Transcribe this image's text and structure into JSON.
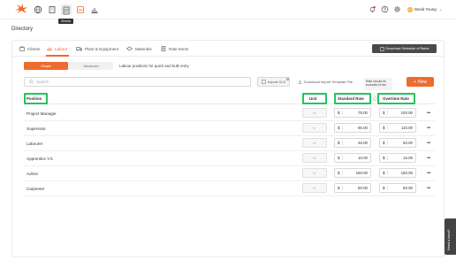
{
  "topbar": {
    "tooltip": "Sheets",
    "user": {
      "initials": "DY",
      "name": "David Young"
    }
  },
  "page": {
    "title": "Directory"
  },
  "tabs": [
    {
      "label": "Clients"
    },
    {
      "label": "Labour"
    },
    {
      "label": "Plant & Equipment"
    },
    {
      "label": "Materials"
    },
    {
      "label": "Rate Items"
    }
  ],
  "toolbar": {
    "download_schedule_label": "Download Schedule of Rates",
    "mode_simple": "Simple",
    "mode_advanced": "Advanced",
    "mode_description": "Labour positions for quick and bulk entry",
    "search_placeholder": "Search",
    "import_label": "Import XLS",
    "template_label": "Download Import Template File",
    "note_text": "Rate should be excluded of tax",
    "new_label": "New"
  },
  "table": {
    "headers": {
      "position": "Position",
      "unit": "Unit",
      "standard_rate": "Standard Rate",
      "overtime_rate": "Overtime Rate"
    },
    "currency": "$",
    "unit_placeholder": "hr",
    "rows": [
      {
        "position": "Project Manager",
        "standard": "75.00",
        "overtime": "100.00"
      },
      {
        "position": "Supervisor",
        "standard": "85.00",
        "overtime": "110.00"
      },
      {
        "position": "Labourer",
        "standard": "45.00",
        "overtime": "60.00"
      },
      {
        "position": "Apprentice Y/1",
        "standard": "10.00",
        "overtime": "15.00"
      },
      {
        "position": "Admin",
        "standard": "150.00",
        "overtime": "150.00"
      },
      {
        "position": "Carpenter",
        "standard": "50.00",
        "overtime": "60.00"
      }
    ]
  },
  "help": {
    "label": "Need a hand?"
  },
  "colors": {
    "accent": "#ee6b2f",
    "highlight": "#22c55e",
    "dark_button": "#4a4a4a"
  }
}
